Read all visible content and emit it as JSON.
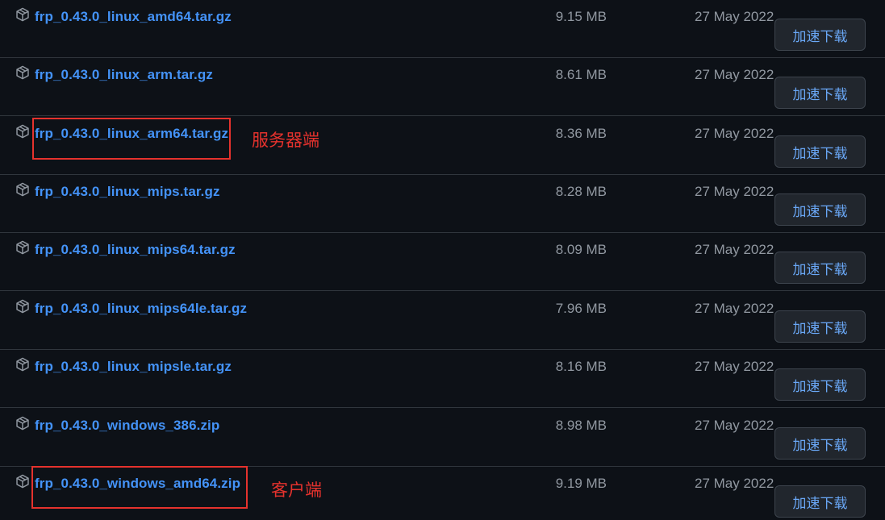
{
  "assets": [
    {
      "name": "frp_0.43.0_linux_amd64.tar.gz",
      "size": "9.15 MB",
      "date": "27 May 2022",
      "button": "加速下载",
      "icon": "package-icon"
    },
    {
      "name": "frp_0.43.0_linux_arm.tar.gz",
      "size": "8.61 MB",
      "date": "27 May 2022",
      "button": "加速下载",
      "icon": "package-icon"
    },
    {
      "name": "frp_0.43.0_linux_arm64.tar.gz",
      "size": "8.36 MB",
      "date": "27 May 2022",
      "button": "加速下载",
      "icon": "package-icon"
    },
    {
      "name": "frp_0.43.0_linux_mips.tar.gz",
      "size": "8.28 MB",
      "date": "27 May 2022",
      "button": "加速下载",
      "icon": "package-icon"
    },
    {
      "name": "frp_0.43.0_linux_mips64.tar.gz",
      "size": "8.09 MB",
      "date": "27 May 2022",
      "button": "加速下载",
      "icon": "package-icon"
    },
    {
      "name": "frp_0.43.0_linux_mips64le.tar.gz",
      "size": "7.96 MB",
      "date": "27 May 2022",
      "button": "加速下载",
      "icon": "package-icon"
    },
    {
      "name": "frp_0.43.0_linux_mipsle.tar.gz",
      "size": "8.16 MB",
      "date": "27 May 2022",
      "button": "加速下载",
      "icon": "package-icon"
    },
    {
      "name": "frp_0.43.0_windows_386.zip",
      "size": "8.98 MB",
      "date": "27 May 2022",
      "button": "加速下载",
      "icon": "package-icon"
    },
    {
      "name": "frp_0.43.0_windows_amd64.zip",
      "size": "9.19 MB",
      "date": "27 May 2022",
      "button": "加速下载",
      "icon": "package-icon"
    }
  ],
  "annotations": {
    "server_label": "服务器端",
    "client_label": "客户端",
    "color": "#e5322d"
  },
  "colors": {
    "background": "#0d1117",
    "link": "#4493f8",
    "muted_text": "#9198a1",
    "button_bg": "#21262d",
    "button_text": "#6aa8f7",
    "divider": "#30363d"
  }
}
